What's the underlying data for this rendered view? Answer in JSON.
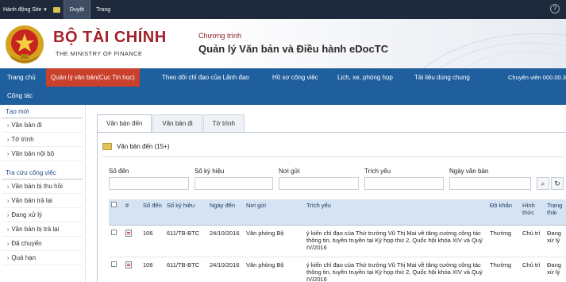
{
  "ribbon": {
    "site_actions": "Hành động Site",
    "tabs": [
      "Duyệt",
      "Trang"
    ]
  },
  "header": {
    "brand_name": "BỘ TÀI CHÍNH",
    "brand_sub": "THE MINISTRY OF FINANCE",
    "program_label": "Chương trình",
    "program_title": "Quản lý Văn bản và Điều hành eDocTC"
  },
  "nav": {
    "items": [
      "Trang chủ",
      "Quản lý văn bản(Cục Tin học)",
      "Theo dõi chỉ đạo của Lãnh đạo",
      "Hồ sơ công việc",
      "Lịch, xe, phòng họp",
      "Tài liệu dùng chung"
    ],
    "second_line": "Cộng tác",
    "user": "Chuyên viên 000.00.3"
  },
  "sidebar": {
    "create_title": "Tạo mới",
    "create_items": [
      "Văn bản đi",
      "Tờ trình",
      "Văn bản nội bộ"
    ],
    "lookup_title": "Tra cứu công việc",
    "lookup_items": [
      "Văn bản bị thu hồi",
      "Văn bản trả lại",
      "Đang xử lý",
      "Văn bản bị trả lại",
      "Đã chuyển",
      "Quá hạn"
    ]
  },
  "tabs": [
    "Văn bản đến",
    "Văn bản đi",
    "Tờ trình"
  ],
  "panel": {
    "title": "Văn bản đến (15+)",
    "filters": [
      "Số đến",
      "Số ký hiệu",
      "Nơi gửi",
      "Trích yếu",
      "Ngày văn bản"
    ]
  },
  "table": {
    "headers": [
      "",
      "#",
      "Số đến",
      "Số ký hiệu",
      "Ngày đến",
      "Nơi gửi",
      "Trích yếu",
      "Độ khẩn",
      "Hình thức",
      "Trạng thái"
    ],
    "rows": [
      {
        "so_den": "106",
        "so_ky_hieu": "611/TB-BTC",
        "ngay_den": "24/10/2016",
        "noi_gui": "Văn phòng Bộ",
        "trich_yeu": "ý kiến chỉ đạo của Thứ trưởng Vũ Thị Mai về tăng cường công tác thông tin, tuyên truyền tại Kỳ họp thứ 2, Quốc hội khóa XIV và Quý IV/2016",
        "do_khan": "Thường",
        "hinh_thuc": "Chủ trì",
        "trang_thai": "Đang xử lý"
      },
      {
        "so_den": "106",
        "so_ky_hieu": "611/TB-BTC",
        "ngay_den": "24/10/2016",
        "noi_gui": "Văn phòng Bộ",
        "trich_yeu": "ý kiến chỉ đạo của Thứ trưởng Vũ Thị Mai về tăng cường công tác thông tin, tuyên truyền tại Kỳ họp thứ 2, Quốc hội khóa XIV và Quý IV/2016",
        "do_khan": "Thường",
        "hinh_thuc": "Chủ trì",
        "trang_thai": "Đang xử lý"
      }
    ]
  },
  "colors": {
    "ribbon": "#1e2a3c",
    "nav": "#1f5f9e",
    "nav_active": "#c9402c",
    "brand": "#a3212a",
    "grid_header": "#d6e3f2",
    "link_red": "#d12b2b"
  },
  "icons": {
    "emblem": "national-emblem-icon",
    "folder": "folder-icon",
    "search": "search-icon",
    "refresh": "refresh-icon",
    "document": "document-icon"
  }
}
